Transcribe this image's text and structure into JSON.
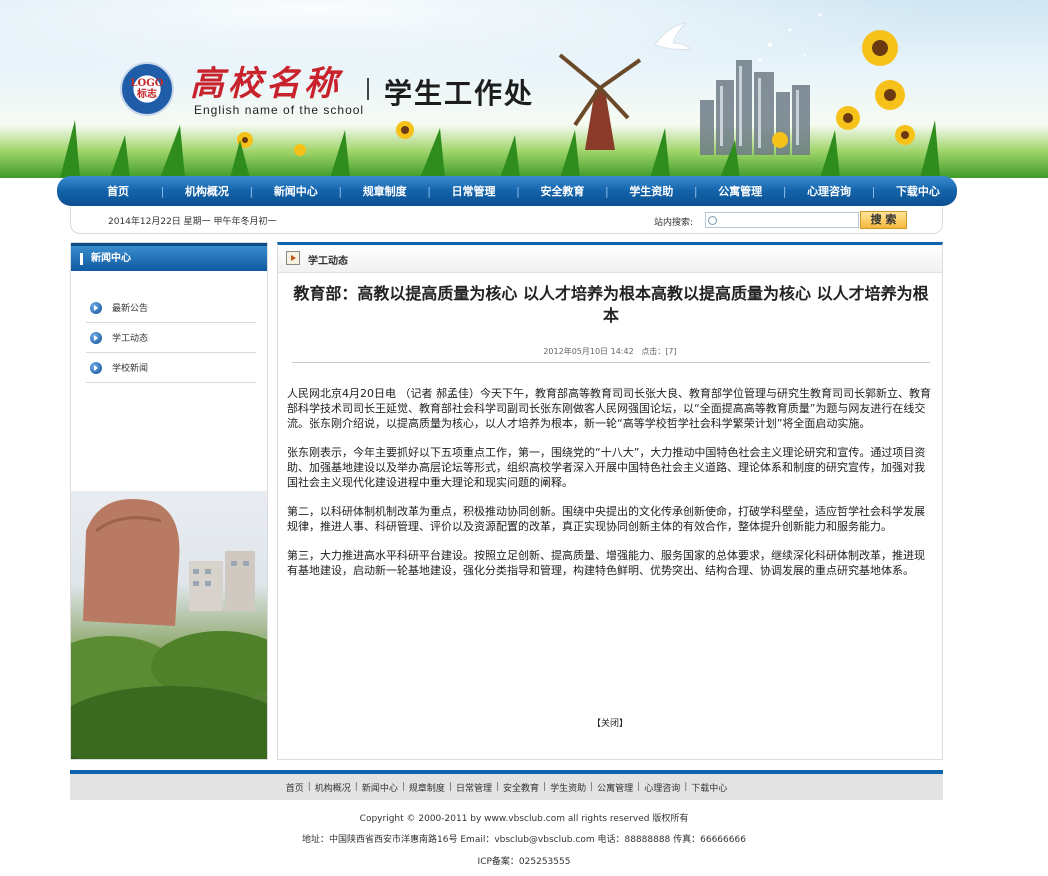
{
  "header": {
    "school_name": "高校名称",
    "school_name_en": "English name of the school",
    "department": "学生工作处",
    "logo_text": "LOGO",
    "logo_sub": "标志"
  },
  "nav": {
    "items": [
      "首页",
      "机构概况",
      "新闻中心",
      "规章制度",
      "日常管理",
      "安全教育",
      "学生资助",
      "公寓管理",
      "心理咨询",
      "下载中心"
    ]
  },
  "infobar": {
    "date": "2014年12月22日   星期一   甲午年冬月初一",
    "search_label": "站内搜索:",
    "search_value": "",
    "search_button": "搜 索"
  },
  "sidebar": {
    "title": "新闻中心",
    "items": [
      "最新公告",
      "学工动态",
      "学校新闻"
    ]
  },
  "main": {
    "section": "学工动态",
    "title": "教育部：高教以提高质量为核心  以人才培养为根本高教以提高质量为核心  以人才培养为根本",
    "meta_date": "2012年05月10日  14:42",
    "meta_hits_label": "点击：",
    "meta_hits": "[7]",
    "paragraphs": [
      "人民网北京4月20日电 （记者 郝孟佳）今天下午，教育部高等教育司司长张大良、教育部学位管理与研究生教育司司长郭新立、教育部科学技术司司长王延觉、教育部社会科学司副司长张东刚做客人民网强国论坛，以“全面提高高等教育质量”为题与网友进行在线交流。张东刚介绍说，以提高质量为核心，以人才培养为根本，新一轮“高等学校哲学社会科学繁荣计划”将全面启动实施。",
      "张东刚表示，今年主要抓好以下五项重点工作，第一，围绕党的“十八大”，大力推动中国特色社会主义理论研究和宣传。通过项目资助、加强基地建设以及举办高层论坛等形式，组织高校学者深入开展中国特色社会主义道路、理论体系和制度的研究宣传，加强对我国社会主义现代化建设进程中重大理论和现实问题的阐释。",
      "第二，以科研体制机制改革为重点，积极推动协同创新。围绕中央提出的文化传承创新使命，打破学科壁垒，适应哲学社会科学发展规律，推进人事、科研管理、评价以及资源配置的改革，真正实现协同创新主体的有效合作，整体提升创新能力和服务能力。",
      "第三，大力推进高水平科研平台建设。按照立足创新、提高质量、增强能力、服务国家的总体要求，继续深化科研体制改革，推进现有基地建设，启动新一轮基地建设，强化分类指导和管理，构建特色鲜明、优势突出、结构合理、协调发展的重点研究基地体系。"
    ],
    "close": "【关闭】"
  },
  "footer": {
    "nav": [
      "首页",
      "机构概况",
      "新闻中心",
      "规章制度",
      "日常管理",
      "安全教育",
      "学生资助",
      "公寓管理",
      "心理咨询",
      "下载中心"
    ],
    "copyright": "Copyright © 2000-2011 by www.vbsclub.com all rights reserved 版权所有",
    "contact": "地址：中国陕西省西安市洋惠南路16号  Email：vbsclub@vbsclub.com 电话：88888888 传真：66666666",
    "icp": "ICP备案：025253555"
  },
  "colors": {
    "brand_blue": "#1063ad",
    "school_red": "#c8232c",
    "search_button": "#f5b93b"
  }
}
